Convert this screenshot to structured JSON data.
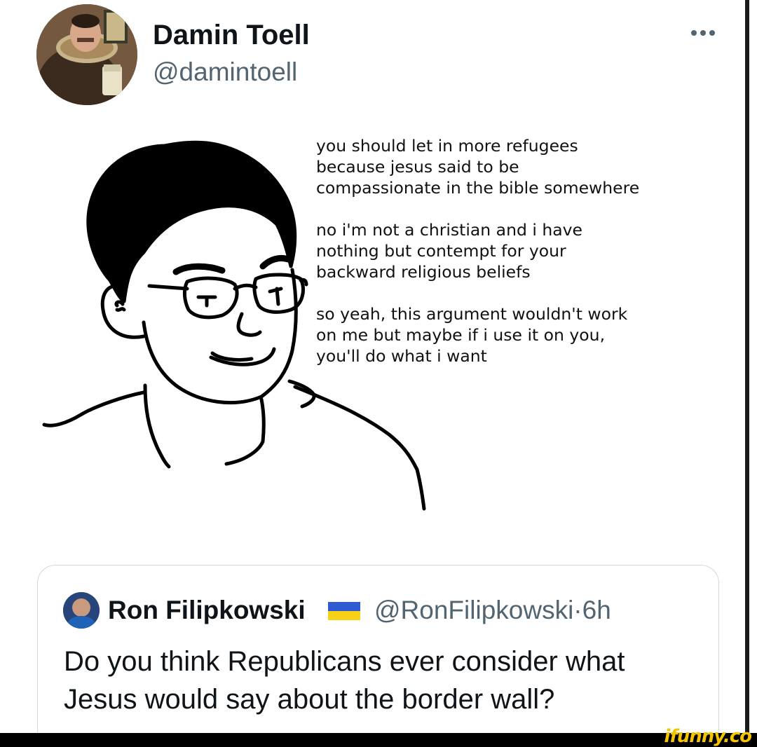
{
  "tweet": {
    "author": {
      "display_name": "Damin Toell",
      "handle": "@damintoell"
    },
    "more_icon": "ellipsis-icon",
    "meme": {
      "paragraphs": [
        "you should let in more refugees\nbecause jesus said to be\ncompassionate in the bible somewhere",
        "no i'm not a christian and i have\nnothing but contempt for your\nbackward religious beliefs",
        "so yeah, this argument wouldn't work\non me but maybe if i use it on you,\nyou'll do what i want"
      ]
    },
    "quoted_tweet": {
      "display_name": "Ron Filipkowski",
      "flag_icon": "ukraine-flag-icon",
      "handle": "@RonFilipkowski",
      "separator": "·",
      "time": "6h",
      "text": "Do you think Republicans ever consider what Jesus would say about the border wall?"
    }
  },
  "watermark": {
    "text": "ifunny.co"
  },
  "colors": {
    "text_primary": "#0f1419",
    "text_secondary": "#536471",
    "card_border": "#cfd9de",
    "flag_blue": "#2e5bd1",
    "flag_yellow": "#f7d117",
    "watermark": "#f5c400"
  }
}
